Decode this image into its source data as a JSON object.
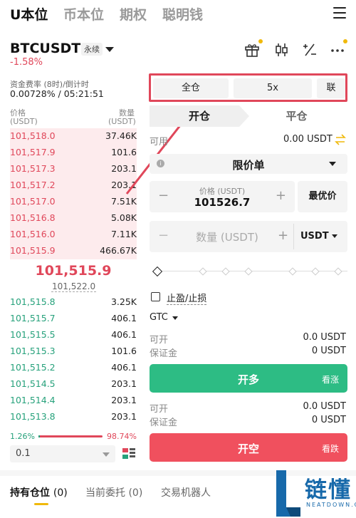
{
  "nav": {
    "tabs": [
      "U本位",
      "币本位",
      "期权",
      "聪明钱"
    ]
  },
  "header": {
    "pair": "BTCUSDT",
    "contract_type": "永续",
    "change": "-1.58%"
  },
  "funding": {
    "label": "资金费率 (8时)/倒计时",
    "value": "0.00728% / 05:21:51"
  },
  "orderbook": {
    "price_header": "价格",
    "price_unit": "(USDT)",
    "qty_header": "数量",
    "qty_unit": "(USDT)",
    "asks": [
      {
        "price": "101,518.0",
        "qty": "37.46K"
      },
      {
        "price": "101,517.9",
        "qty": "101.6"
      },
      {
        "price": "101,517.3",
        "qty": "203.1"
      },
      {
        "price": "101,517.2",
        "qty": "203.1"
      },
      {
        "price": "101,517.0",
        "qty": "7.51K"
      },
      {
        "price": "101,516.8",
        "qty": "5.08K"
      },
      {
        "price": "101,516.0",
        "qty": "7.11K"
      },
      {
        "price": "101,515.9",
        "qty": "466.67K"
      }
    ],
    "last_price": "101,515.9",
    "mark_price": "101,522.0",
    "bids": [
      {
        "price": "101,515.8",
        "qty": "3.25K"
      },
      {
        "price": "101,515.7",
        "qty": "406.1"
      },
      {
        "price": "101,515.5",
        "qty": "406.1"
      },
      {
        "price": "101,515.3",
        "qty": "101.6"
      },
      {
        "price": "101,515.2",
        "qty": "406.1"
      },
      {
        "price": "101,514.5",
        "qty": "203.1"
      },
      {
        "price": "101,514.4",
        "qty": "203.1"
      },
      {
        "price": "101,513.8",
        "qty": "203.1"
      }
    ],
    "buy_ratio": "1.26%",
    "sell_ratio": "98.74%",
    "depth": "0.1"
  },
  "trade": {
    "margin_mode": "全仓",
    "leverage": "5x",
    "mode_short": "联",
    "open_tab": "开仓",
    "close_tab": "平仓",
    "available_label": "可用",
    "available_value": "0.00 USDT",
    "order_type": "限价单",
    "price_label": "价格 (USDT)",
    "price_value": "101526.7",
    "best_price": "最优价",
    "qty_placeholder": "数量 (USDT)",
    "qty_unit": "USDT",
    "tp_sl": "止盈/止损",
    "tif": "GTC",
    "long_can_open_label": "可开",
    "long_can_open_value": "0.0 USDT",
    "long_margin_label": "保证金",
    "long_margin_value": "0 USDT",
    "long_button": "开多",
    "long_sub": "看涨",
    "short_can_open_label": "可开",
    "short_can_open_value": "0.0 USDT",
    "short_margin_label": "保证金",
    "short_margin_value": "0 USDT",
    "short_button": "开空",
    "short_sub": "看跌"
  },
  "bottom_tabs": [
    {
      "label": "持有仓位",
      "count": "(0)"
    },
    {
      "label": "当前委托",
      "count": "(0)"
    },
    {
      "label": "交易机器人",
      "count": ""
    }
  ],
  "watermark": {
    "cn": "链懂",
    "en": "NEATDOWN.COM"
  },
  "colors": {
    "red": "#e0475a",
    "green": "#26a17b",
    "long": "#2dbc84",
    "short": "#f0505e",
    "accent": "#f0b90b"
  }
}
